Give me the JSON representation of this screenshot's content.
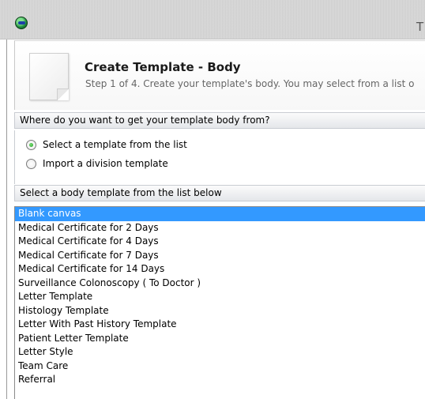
{
  "window": {
    "title": "T"
  },
  "header": {
    "title": "Create Template - Body",
    "subtitle": "Step 1 of 4. Create your template's body. You may select from a list o"
  },
  "source_section": {
    "question": "Where do you want to get your template body from?",
    "options": [
      {
        "label": "Select a template from the list",
        "checked": true
      },
      {
        "label": "Import a division template",
        "checked": false
      }
    ]
  },
  "list_section": {
    "heading": "Select a body template from the list below",
    "items": [
      "Blank canvas",
      "Medical Certificate for 2 Days",
      "Medical Certificate for 4 Days",
      "Medical Certificate for 7 Days",
      "Medical Certificate for 14 Days",
      "Surveillance Colonoscopy ( To Doctor )",
      "Letter Template",
      "Histology Template",
      "Letter With Past History Template",
      "Patient Letter Template",
      "Letter Style",
      "Team Care",
      "Referral"
    ],
    "selected_index": 0
  },
  "colors": {
    "selection": "#3399ff",
    "section_header_bg": "#e4e6ea"
  }
}
